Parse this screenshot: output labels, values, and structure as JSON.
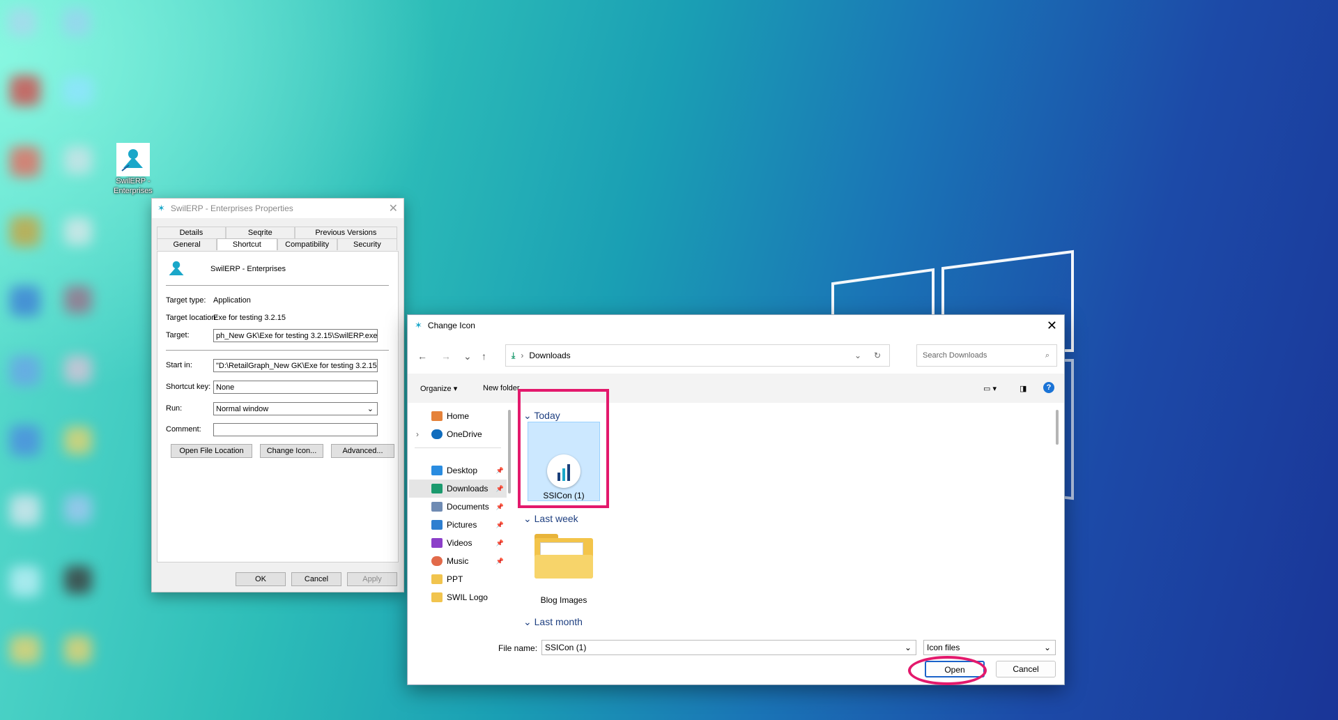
{
  "desktop": {
    "shortcut_label": "SwilERP - Enterprises"
  },
  "props": {
    "title": "SwilERP - Enterprises Properties",
    "tabs_row1": [
      "Details",
      "Seqrite",
      "Previous Versions"
    ],
    "tabs_row2": [
      "General",
      "Shortcut",
      "Compatibility",
      "Security"
    ],
    "active_tab": "Shortcut",
    "app_name": "SwilERP - Enterprises",
    "target_type_label": "Target type:",
    "target_type_value": "Application",
    "target_location_label": "Target location:",
    "target_location_value": "Exe for testing 3.2.15",
    "target_label": "Target:",
    "target_value": "ph_New GK\\Exe for testing 3.2.15\\SwilERP.exe\"",
    "start_in_label": "Start in:",
    "start_in_value": "\"D:\\RetailGraph_New GK\\Exe for testing 3.2.15\"",
    "shortcut_key_label": "Shortcut key:",
    "shortcut_key_value": "None",
    "run_label": "Run:",
    "run_value": "Normal window",
    "comment_label": "Comment:",
    "comment_value": "",
    "open_location_btn": "Open File Location",
    "change_icon_btn": "Change Icon...",
    "advanced_btn": "Advanced...",
    "ok_btn": "OK",
    "cancel_btn": "Cancel",
    "apply_btn": "Apply"
  },
  "change_icon": {
    "title": "Change Icon",
    "address": "Downloads",
    "search_placeholder": "Search Downloads",
    "organize": "Organize",
    "new_folder": "New folder",
    "nav": {
      "home": "Home",
      "onedrive": "OneDrive",
      "desktop": "Desktop",
      "downloads": "Downloads",
      "documents": "Documents",
      "pictures": "Pictures",
      "videos": "Videos",
      "music": "Music",
      "ppt": "PPT",
      "swil_logo": "SWIL Logo"
    },
    "groups": {
      "today": "Today",
      "last_week": "Last week",
      "last_month": "Last month"
    },
    "files": {
      "ssicon": "SSICon (1)",
      "blog_images": "Blog Images"
    },
    "file_name_label": "File name:",
    "file_name_value": "SSICon (1)",
    "file_type_value": "Icon files",
    "open_btn": "Open",
    "cancel_btn": "Cancel",
    "colors": {
      "highlight": "#e3196c",
      "selected_file": "#cce8ff"
    }
  }
}
